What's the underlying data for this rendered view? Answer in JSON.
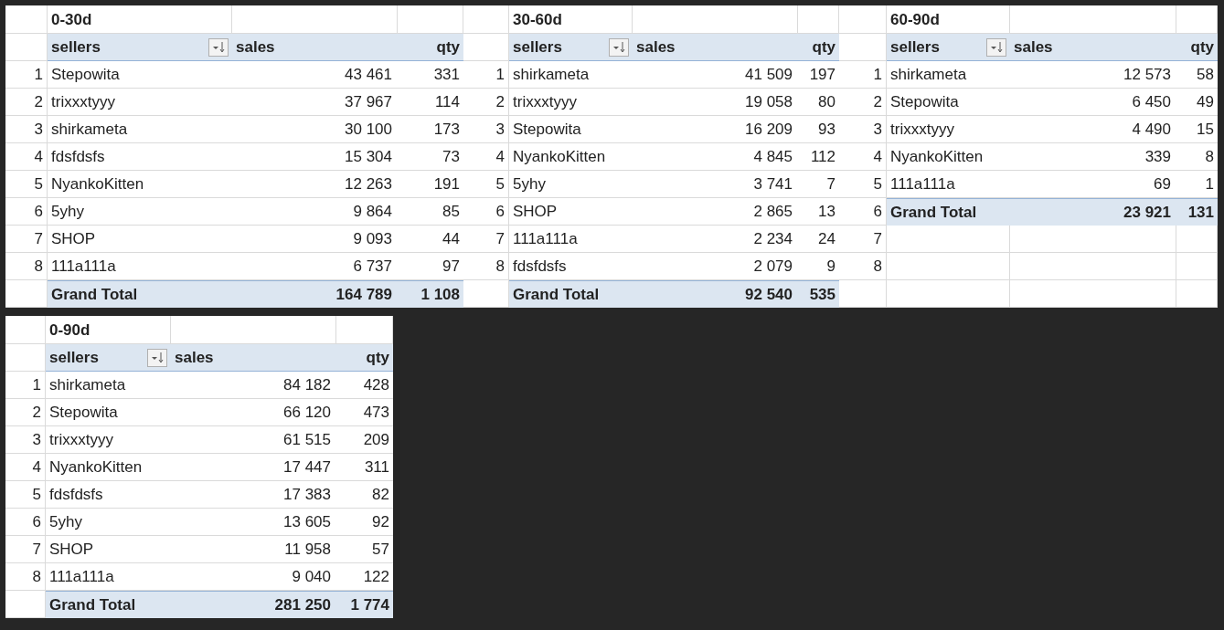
{
  "pivots": [
    {
      "title": "0-30d",
      "columns": [
        "sellers",
        "sales",
        "qty"
      ],
      "row_labels": [
        "1",
        "2",
        "3",
        "4",
        "5",
        "6",
        "7",
        "8"
      ],
      "rows": [
        [
          "Stepowita",
          "43 461",
          "331"
        ],
        [
          "trixxxtyyy",
          "37 967",
          "114"
        ],
        [
          "shirkameta",
          "30 100",
          "173"
        ],
        [
          "fdsfdsfs",
          "15 304",
          "73"
        ],
        [
          "NyankoKitten",
          "12 263",
          "191"
        ],
        [
          "5yhy",
          "9 864",
          "85"
        ],
        [
          "SHOP",
          "9 093",
          "44"
        ],
        [
          "111a111a",
          "6 737",
          "97"
        ]
      ],
      "total": [
        "Grand Total",
        "164 789",
        "1 108"
      ]
    },
    {
      "title": "30-60d",
      "columns": [
        "sellers",
        "sales",
        "qty"
      ],
      "row_labels": [
        "1",
        "2",
        "3",
        "4",
        "5",
        "6",
        "7",
        "8"
      ],
      "rows": [
        [
          "shirkameta",
          "41 509",
          "197"
        ],
        [
          "trixxxtyyy",
          "19 058",
          "80"
        ],
        [
          "Stepowita",
          "16 209",
          "93"
        ],
        [
          "NyankoKitten",
          "4 845",
          "112"
        ],
        [
          "5yhy",
          "3 741",
          "7"
        ],
        [
          "SHOP",
          "2 865",
          "13"
        ],
        [
          "111a111a",
          "2 234",
          "24"
        ],
        [
          "fdsfdsfs",
          "2 079",
          "9"
        ]
      ],
      "total": [
        "Grand Total",
        "92 540",
        "535"
      ]
    },
    {
      "title": "60-90d",
      "columns": [
        "sellers",
        "sales",
        "qty"
      ],
      "row_labels": [
        "1",
        "2",
        "3",
        "4",
        "5",
        "6",
        "7",
        "8"
      ],
      "rows": [
        [
          "shirkameta",
          "12 573",
          "58"
        ],
        [
          "Stepowita",
          "6 450",
          "49"
        ],
        [
          "trixxxtyyy",
          "4 490",
          "15"
        ],
        [
          "NyankoKitten",
          "339",
          "8"
        ],
        [
          "111a111a",
          "69",
          "1"
        ]
      ],
      "total": [
        "Grand Total",
        "23 921",
        "131"
      ]
    },
    {
      "title": "0-90d",
      "columns": [
        "sellers",
        "sales",
        "qty"
      ],
      "row_labels": [
        "1",
        "2",
        "3",
        "4",
        "5",
        "6",
        "7",
        "8"
      ],
      "rows": [
        [
          "shirkameta",
          "84 182",
          "428"
        ],
        [
          "Stepowita",
          "66 120",
          "473"
        ],
        [
          "trixxxtyyy",
          "61 515",
          "209"
        ],
        [
          "NyankoKitten",
          "17 447",
          "311"
        ],
        [
          "fdsfdsfs",
          "17 383",
          "82"
        ],
        [
          "5yhy",
          "13 605",
          "92"
        ],
        [
          "SHOP",
          "11 958",
          "57"
        ],
        [
          "111a111a",
          "9 040",
          "122"
        ]
      ],
      "total": [
        "Grand Total",
        "281 250",
        "1 774"
      ]
    }
  ]
}
